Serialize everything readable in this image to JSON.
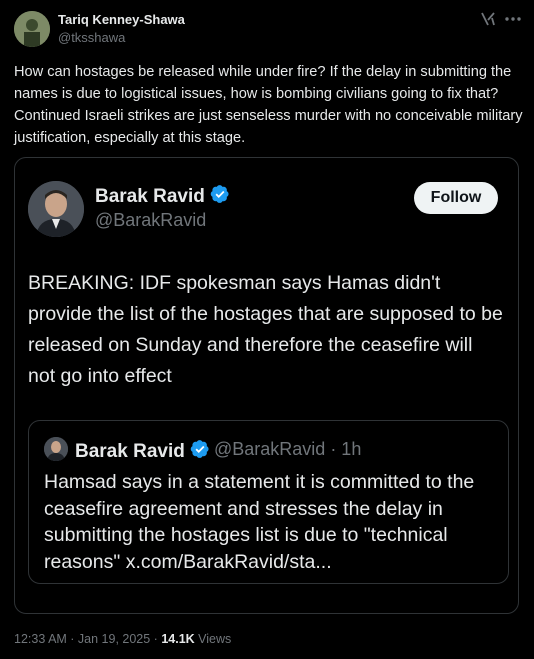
{
  "tweet": {
    "author_name": "Tariq Kenney-Shawa",
    "author_handle": "@tksshawa",
    "text": "How can hostages be released while under fire? If the delay in submitting the names is due to logistical issues, how is bombing civilians going to fix that? Continued Israeli strikes are just senseless murder with no conceivable military justification, especially at this stage.",
    "time": "12:33 AM · Jan 19, 2025 · ",
    "views_count": "14.1K",
    "views_label": " Views"
  },
  "quoted": {
    "author_name": "Barak Ravid",
    "author_handle": "@BarakRavid",
    "follow_label": "Follow",
    "text": "BREAKING: IDF spokesman says Hamas didn't provide the list of the hostages that are supposed to be released on Sunday and therefore the ceasefire will not go into effect",
    "nested": {
      "author_name": "Barak Ravid",
      "handle_time": "@BarakRavid · 1h",
      "text": "Hamsad says in a statement it is committed to the ceasefire agreement and stresses the delay in submitting the hostages list is due to \"technical reasons\" x.com/BarakRavid/sta..."
    }
  },
  "colors": {
    "background": "#000000",
    "text": "#e7e9ea",
    "secondary": "#71767b",
    "verified": "#1d9bf0",
    "border": "#2f3336"
  },
  "icons": [
    "grok-icon",
    "more-icon",
    "verified-badge-icon"
  ]
}
